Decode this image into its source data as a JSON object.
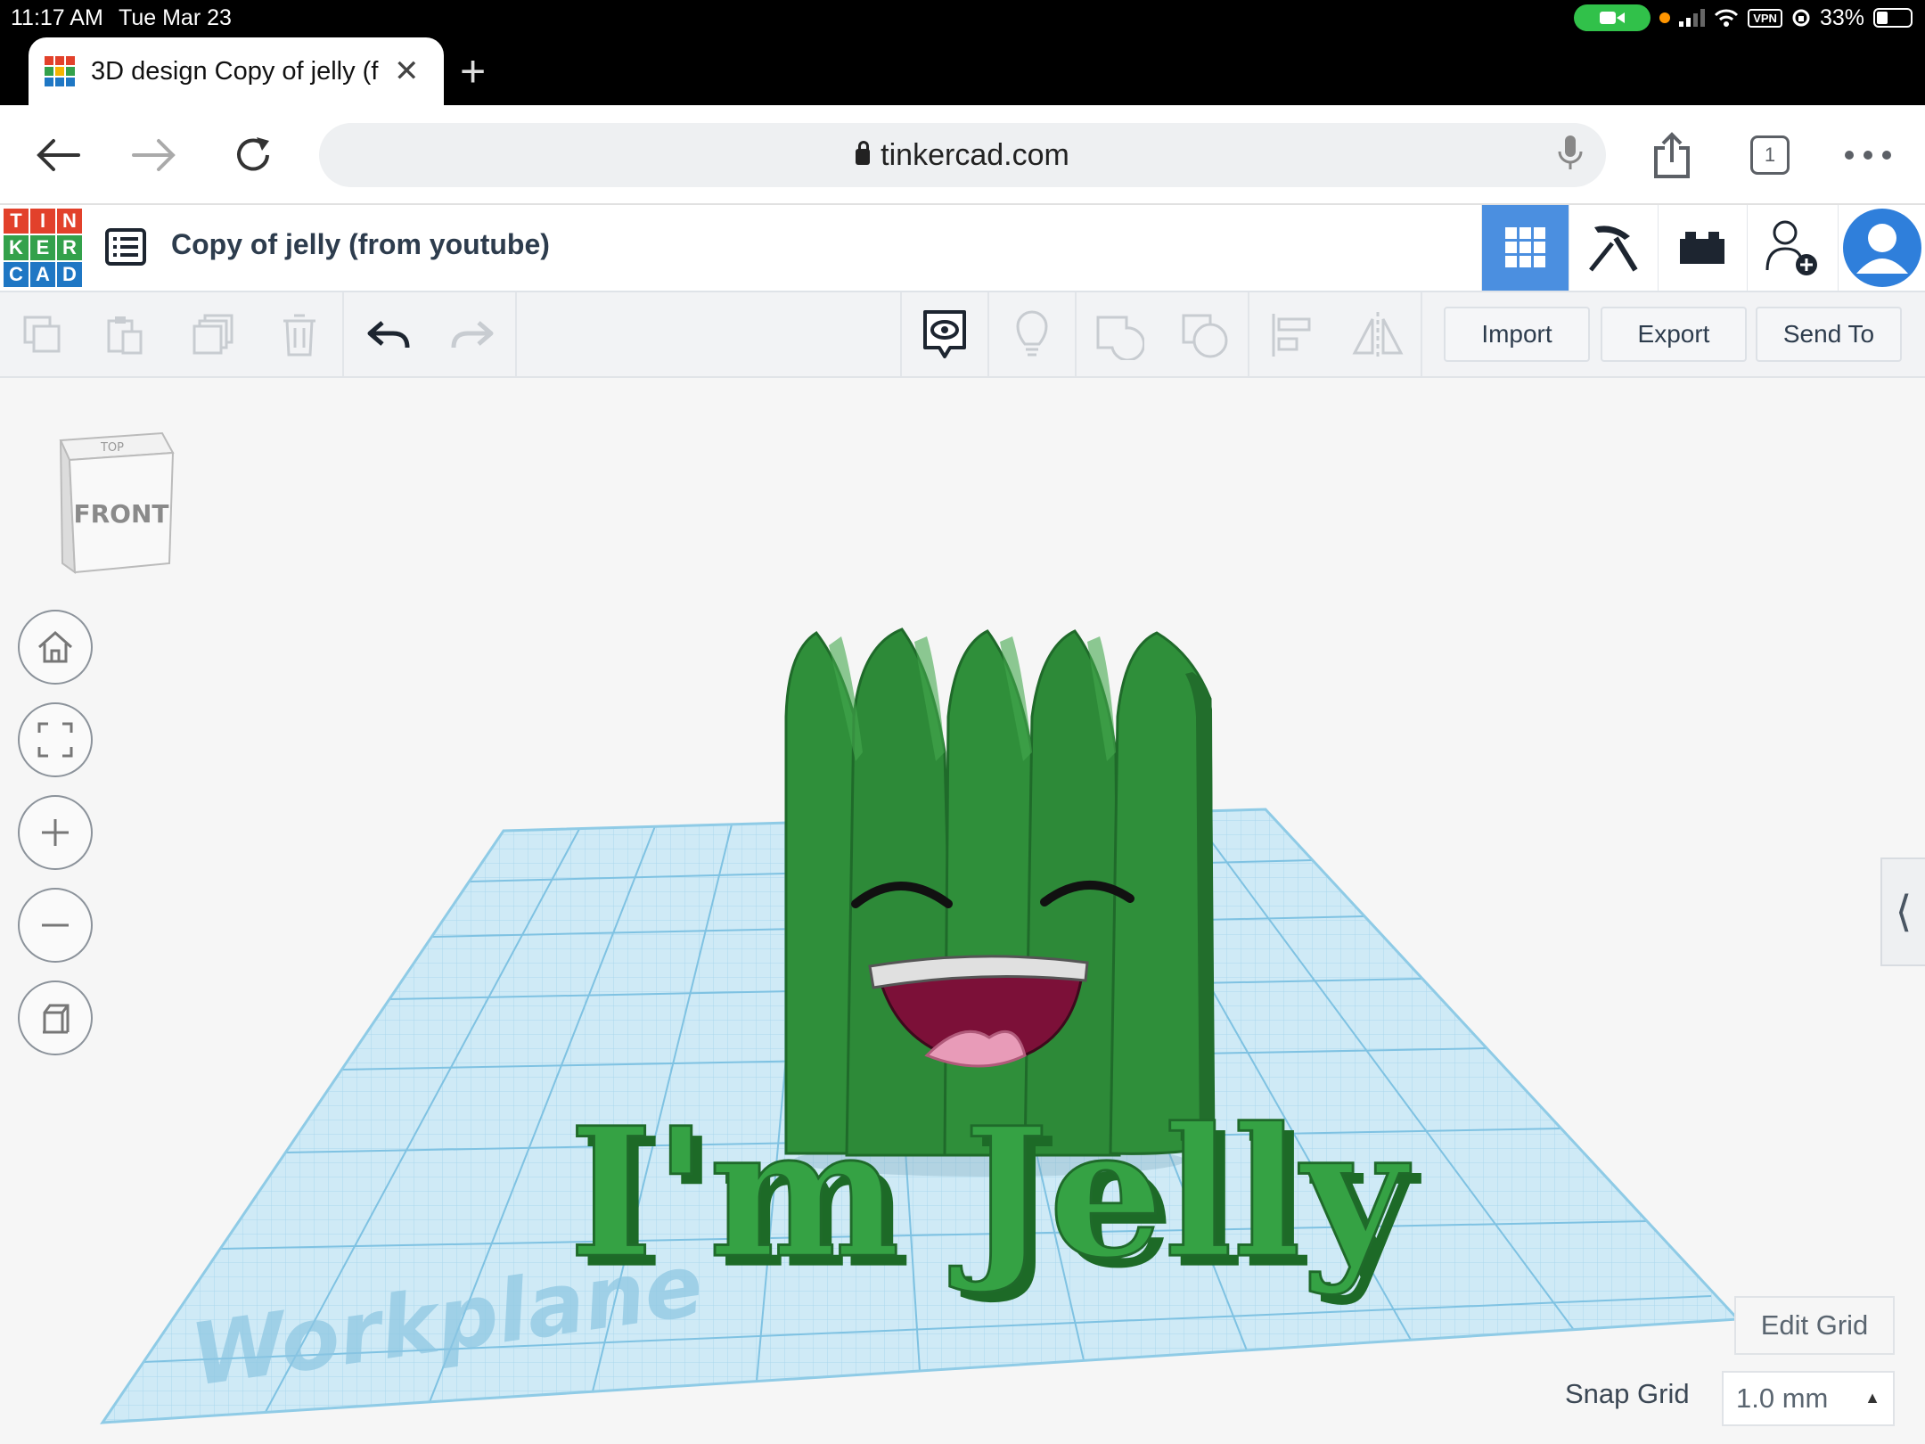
{
  "status_bar": {
    "time": "11:17 AM",
    "date": "Tue Mar 23",
    "battery": "33%",
    "battery_level": 0.33,
    "vpn": "VPN"
  },
  "browser": {
    "tab_title": "3D design Copy of jelly (f",
    "url": "tinkercad.com",
    "tab_count": "1"
  },
  "app": {
    "logo_letters": [
      "T",
      "I",
      "N",
      "K",
      "E",
      "R",
      "C",
      "A",
      "D"
    ],
    "logo_colors": [
      "#e2412b",
      "#e2412b",
      "#e2412b",
      "#33a14b",
      "#33a14b",
      "#33a14b",
      "#1f77c4",
      "#1f77c4",
      "#1f77c4"
    ],
    "design_title": "Copy of jelly (from youtube)",
    "accent": "#4b8fe0"
  },
  "toolbar": {
    "import": "Import",
    "export": "Export",
    "send_to": "Send To"
  },
  "viewport": {
    "viewcube_front": "FRONT",
    "viewcube_top": "TOP",
    "workplane_label": "Workplane",
    "model_text": "I'm Jelly",
    "edit_grid": "Edit Grid",
    "snap_grid_label": "Snap Grid",
    "snap_grid_value": "1.0 mm",
    "model_color": "#2e8f3a",
    "grid_color": "#a9d8ee"
  },
  "icons": [
    "back-icon",
    "forward-icon",
    "reload-icon",
    "lock-icon",
    "mic-icon",
    "share-icon",
    "tabs-icon",
    "more-icon",
    "design-list-icon",
    "grid-view-icon",
    "build-icon",
    "bricks-icon",
    "invite-user-icon",
    "avatar-icon",
    "copy-icon",
    "paste-icon",
    "duplicate-icon",
    "delete-icon",
    "undo-icon",
    "redo-icon",
    "notes-icon",
    "light-icon",
    "group-icon",
    "ungroup-icon",
    "align-icon",
    "mirror-icon",
    "home-view-icon",
    "fit-view-icon",
    "zoom-in-icon",
    "zoom-out-icon",
    "ortho-icon",
    "chevron-left-icon"
  ]
}
